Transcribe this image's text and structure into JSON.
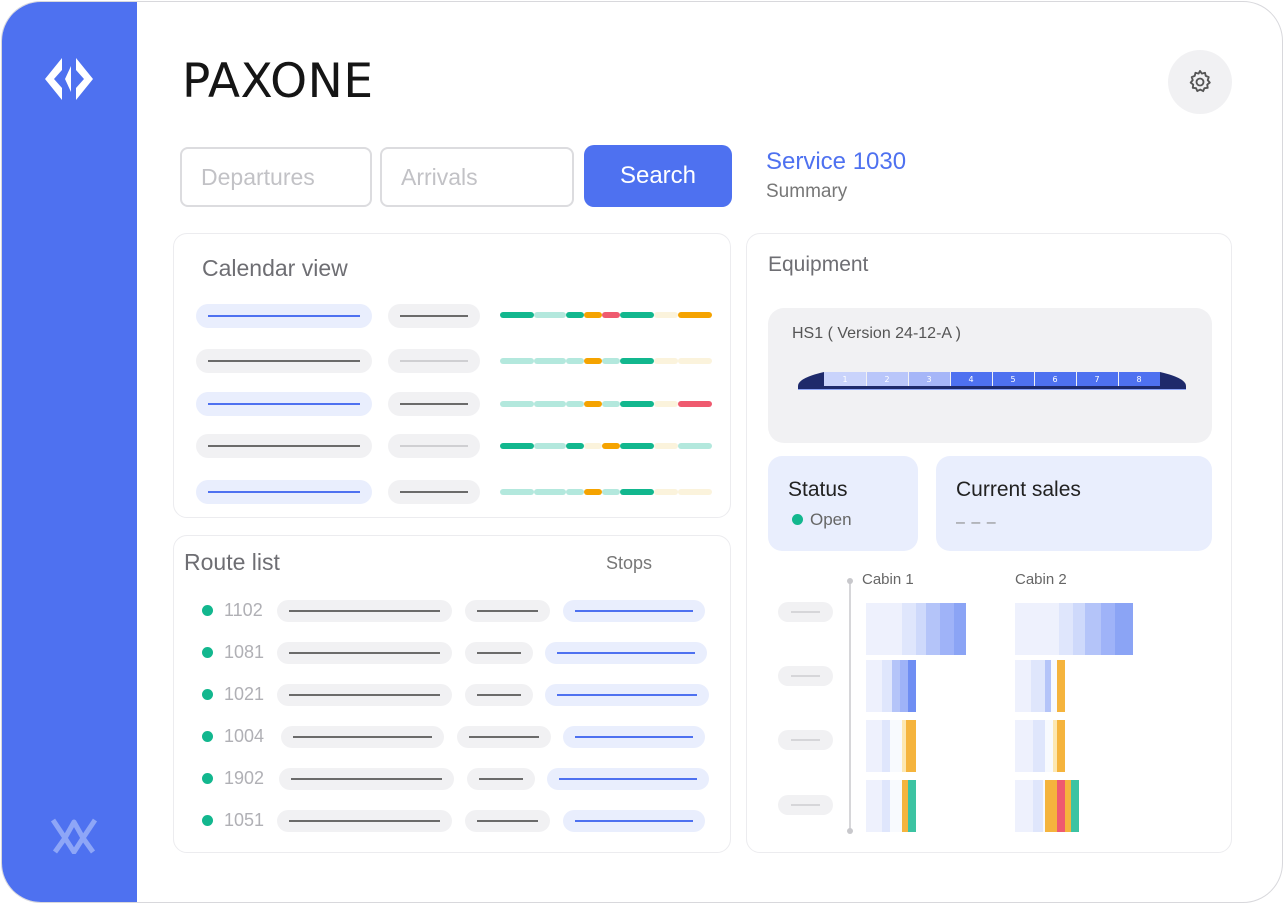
{
  "app": {
    "title": "PAXONE"
  },
  "search": {
    "departures_placeholder": "Departures",
    "arrivals_placeholder": "Arrivals",
    "button_label": "Search"
  },
  "service": {
    "title": "Service 1030",
    "subtitle": "Summary"
  },
  "calendar": {
    "title": "Calendar view"
  },
  "routes": {
    "title": "Route list",
    "stops_header": "Stops",
    "items": [
      {
        "id": "1102",
        "status": "active"
      },
      {
        "id": "1081",
        "status": "active"
      },
      {
        "id": "1021",
        "status": "active"
      },
      {
        "id": "1004",
        "status": "active"
      },
      {
        "id": "1902",
        "status": "active"
      },
      {
        "id": "1051",
        "status": "active"
      }
    ]
  },
  "equipment": {
    "title": "Equipment",
    "train_label": "HS1 ( Version 24-12-A )",
    "cars": [
      "1",
      "2",
      "3",
      "4",
      "5",
      "6",
      "7",
      "8"
    ]
  },
  "status": {
    "title": "Status",
    "value": "Open",
    "color": "#12b78e"
  },
  "sales": {
    "title": "Current sales",
    "value": "– – –"
  },
  "cabins": {
    "cabin1": "Cabin 1",
    "cabin2": "Cabin 2"
  },
  "colors": {
    "accent": "#4e71f0",
    "green": "#12b78e",
    "mint": "#b3e8dd",
    "orange": "#f5a300",
    "red": "#ef5a6f",
    "cream": "#fbf3dc"
  },
  "icons": {
    "settings": "gear-icon",
    "logo": "app-logo-icon",
    "brand": "brand-mark-icon"
  }
}
